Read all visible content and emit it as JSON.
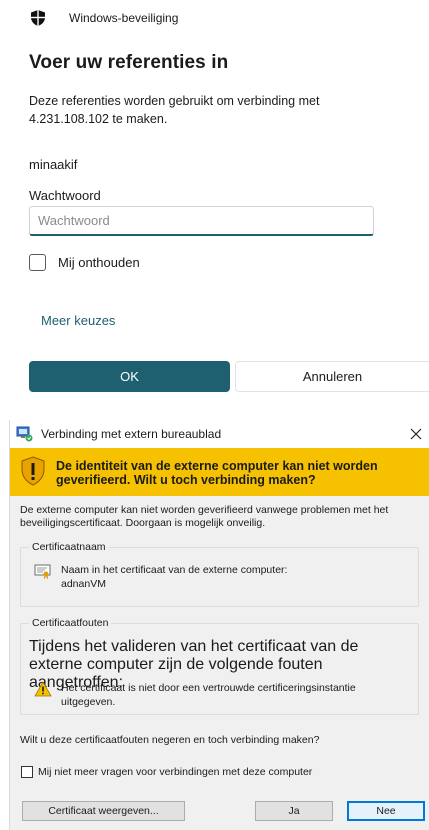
{
  "security_dialog": {
    "header_title": "Windows-beveiliging",
    "heading": "Voer uw referenties in",
    "description": "Deze referenties worden gebruikt om verbinding met 4.231.108.102 te maken.",
    "username": "minaakif",
    "password_label": "Wachtwoord",
    "password_placeholder": "Wachtwoord",
    "password_value": "",
    "remember_label": "Mij onthouden",
    "remember_checked": false,
    "more_choices": "Meer keuzes",
    "ok_label": "OK",
    "cancel_label": "Annuleren",
    "accent_color": "#1f6070"
  },
  "rdp_dialog": {
    "title": "Verbinding met extern bureaublad",
    "warning_banner": "De identiteit van de externe computer kan niet worden geverifieerd. Wilt u toch verbinding maken?",
    "intro": "De externe computer kan niet worden geverifieerd vanwege problemen met het beveiligingscertificaat. Doorgaan is mogelijk onveilig.",
    "cert_name_group_title": "Certificaatnaam",
    "cert_name_label": "Naam in het certificaat van de externe computer:",
    "cert_name_value": "adnanVM",
    "cert_errors_group_title": "Certificaatfouten",
    "cert_errors_intro": "Tijdens het valideren van het certificaat van de externe computer zijn de volgende fouten aangetroffen:",
    "cert_error_1": "Het certificaat is niet door een vertrouwde certificeringsinstantie uitgegeven.",
    "question": "Wilt u deze certificaatfouten negeren en toch verbinding maken?",
    "dont_ask_label": "Mij niet meer vragen voor verbindingen met deze computer",
    "dont_ask_checked": false,
    "view_cert_label": "Certificaat weergeven...",
    "yes_label": "Ja",
    "no_label": "Nee",
    "banner_color": "#f5c100"
  }
}
